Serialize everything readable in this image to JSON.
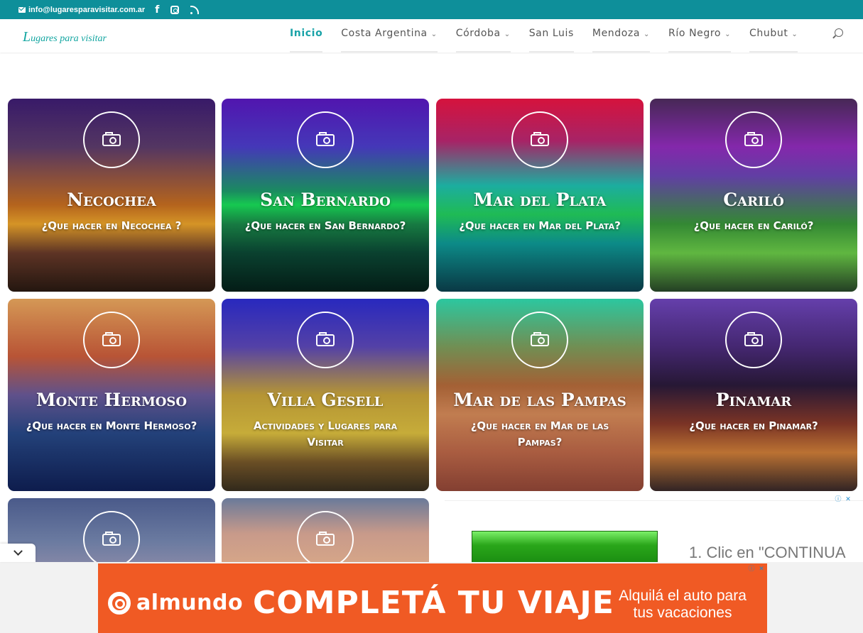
{
  "topbar": {
    "email": "info@lugaresparavisitar.com.ar",
    "social": [
      "facebook-icon",
      "instagram-icon",
      "rss-icon"
    ]
  },
  "header": {
    "logo_L": "L",
    "logo_rest": "ugares para visitar",
    "nav": [
      {
        "label": "Inicio",
        "active": true
      },
      {
        "label": "Costa Argentina",
        "dropdown": true
      },
      {
        "label": "Córdoba",
        "dropdown": true
      },
      {
        "label": "San Luis"
      },
      {
        "label": "Mendoza",
        "dropdown": true
      },
      {
        "label": "Río Negro",
        "dropdown": true
      },
      {
        "label": "Chubut",
        "dropdown": true
      }
    ]
  },
  "cards": [
    {
      "title": "Necochea",
      "subtitle": "¿Que hacer en Necochea ?"
    },
    {
      "title": "San Bernardo",
      "subtitle": "¿Que hacer en San Bernardo?"
    },
    {
      "title": "Mar del Plata",
      "subtitle": "¿Que hacer en Mar del Plata?"
    },
    {
      "title": "Cariló",
      "subtitle": "¿Que hacer en Cariló?"
    },
    {
      "title": "Monte Hermoso",
      "subtitle": "¿Que hacer en Monte Hermoso?"
    },
    {
      "title": "Villa Gesell",
      "subtitle": "Actividades y Lugares para Visitar"
    },
    {
      "title": "Mar de las Pampas",
      "subtitle": "¿Que hacer en Mar de las Pampas?"
    },
    {
      "title": "Pinamar",
      "subtitle": "¿Que hacer en Pinamar?"
    },
    {
      "title": "",
      "subtitle": ""
    },
    {
      "title": "",
      "subtitle": ""
    }
  ],
  "side_ad": {
    "text": "1. Clic en \"CONTINUA"
  },
  "banner": {
    "brand": "almundo",
    "headline": "COMPLETÁ TU VIAJE",
    "tagline": "Alquilá el auto para tus vacaciones"
  },
  "colors": {
    "topbar": "#0e8f9a",
    "accent": "#1aa3a8",
    "banner": "#f05a24"
  }
}
